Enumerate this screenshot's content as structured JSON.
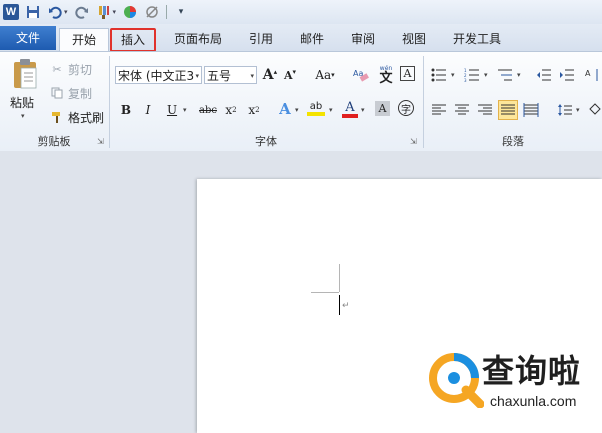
{
  "qat": {
    "app_icon_letter": "W",
    "icons": [
      "save-icon",
      "undo-icon",
      "redo-icon",
      "format-painter-icon",
      "color-wheel-icon",
      "no-style-icon",
      "customize-icon"
    ]
  },
  "tabs": [
    {
      "label": "文件"
    },
    {
      "label": "开始"
    },
    {
      "label": "插入"
    },
    {
      "label": "页面布局"
    },
    {
      "label": "引用"
    },
    {
      "label": "邮件"
    },
    {
      "label": "审阅"
    },
    {
      "label": "视图"
    },
    {
      "label": "开发工具"
    }
  ],
  "clipboard": {
    "paste_label": "粘贴",
    "cut_label": "剪切",
    "copy_label": "复制",
    "format_painter_label": "格式刷",
    "group_label": "剪贴板"
  },
  "font": {
    "font_name": "宋体 (中文正3",
    "font_size": "五号",
    "grow_label": "A",
    "shrink_label": "A",
    "case_label": "Aa",
    "bold_label": "B",
    "italic_label": "I",
    "underline_label": "U",
    "strike_label": "abc",
    "subscript_label": "x",
    "subscript_mark": "2",
    "superscript_label": "x",
    "superscript_mark": "2",
    "effects_label": "A",
    "highlight_label": "ab",
    "font_color_label": "A",
    "char_shading_label": "A",
    "enclose_label": "字",
    "phonetic_label": "文",
    "phonetic_top": "wén",
    "border_label": "A",
    "group_label": "字体",
    "highlight_color": "#f4e300",
    "font_color": "#e02020"
  },
  "paragraph": {
    "group_label": "段落",
    "justify_active": true
  },
  "watermark": {
    "title": "查询啦",
    "subtitle": "chaxunla.com",
    "brand_color": "#f5a623",
    "accent_color": "#1b8fe0"
  }
}
